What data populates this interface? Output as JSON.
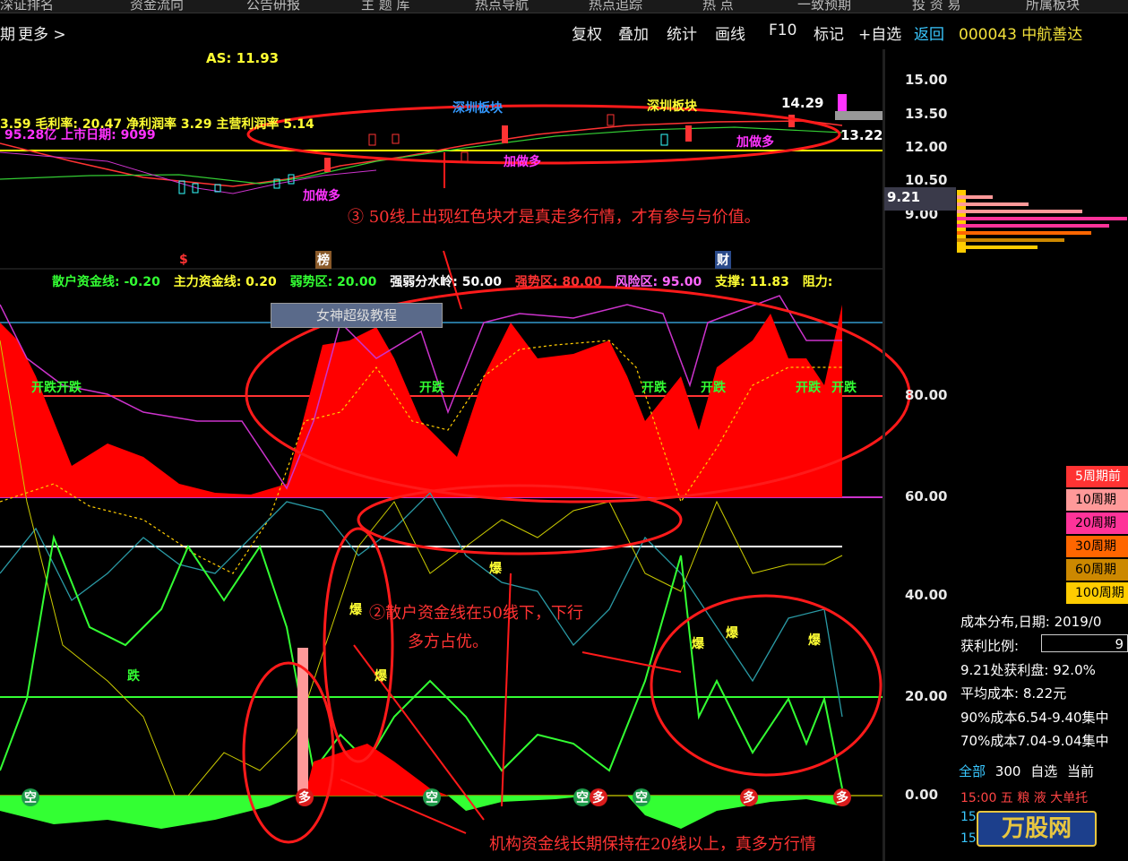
{
  "top_nav": [
    "深证排名",
    "资金流向",
    "公告研报",
    "主 题 库",
    "热点导航",
    "热点追踪",
    "热 点",
    "一致预期",
    "投 资 易",
    "所属板块"
  ],
  "toolbar": {
    "left_partial": "期",
    "more": "更多 >",
    "items": [
      "复权",
      "叠加",
      "统计",
      "画线",
      "F10",
      "标记",
      "+自选"
    ],
    "return": "返回",
    "stock": "000043 中航善达"
  },
  "price_chart": {
    "as_label": "AS: 11.93",
    "info_line1": "3.59 毛利率: 20.47 净利润率 3.29 主营利润率 5.14",
    "info_line2": "95.28亿 上市日期: 9099",
    "tags": [
      "深圳板块",
      "深圳板块",
      "加做多",
      "加做多",
      "加做多"
    ],
    "high_label": "14.29",
    "last_label": "13.22",
    "current_price": "9.21",
    "y_ticks": [
      "15.00",
      "13.50",
      "12.00",
      "10.50",
      "9.00"
    ],
    "markers": [
      "$",
      "榜",
      "财"
    ]
  },
  "indicator": {
    "header": [
      {
        "text": "散户资金线: -0.20",
        "color": "#33ff33"
      },
      {
        "text": "主力资金线: 0.20",
        "color": "#ffff33"
      },
      {
        "text": "弱势区: 20.00",
        "color": "#33ff33"
      },
      {
        "text": "强弱分水岭: 50.00",
        "color": "#ffffff"
      },
      {
        "text": "强势区: 80.00",
        "color": "#ff3333"
      },
      {
        "text": "风险区: 95.00",
        "color": "#ff66ff"
      },
      {
        "text": "支撑: 11.83",
        "color": "#ffff33"
      },
      {
        "text": "阻力: ",
        "color": "#ffff33"
      }
    ],
    "banner": "女神超级教程",
    "y_ticks": [
      "80.00",
      "60.00",
      "40.00",
      "20.00",
      "0.00"
    ],
    "kai_labels": [
      "开跌开跌",
      "开跌",
      "开跌",
      "开跌",
      "开跌",
      "开跌"
    ],
    "bao_labels": [
      "爆",
      "爆",
      "爆",
      "爆",
      "爆",
      "爆"
    ],
    "die_label": "跌",
    "kong_labels": [
      "空",
      "空",
      "空",
      "空"
    ],
    "duo_labels": [
      "多",
      "多",
      "多",
      "多"
    ]
  },
  "annotations": {
    "a3": "③ 50线上出现红色块才是真走多行情，才有参与与价值。",
    "a2_line1": "②散户资金线在50线下，下行",
    "a2_line2": "多方占优。",
    "a1": "机构资金线长期保持在20线以上，真多方行情"
  },
  "cost_panel": {
    "legend": [
      {
        "label": "5周期前",
        "color": "#ff3333"
      },
      {
        "label": "10周期",
        "color": "#ff9999"
      },
      {
        "label": "20周期",
        "color": "#ff3399"
      },
      {
        "label": "30周期",
        "color": "#ff6600"
      },
      {
        "label": "60周期",
        "color": "#cc8800"
      },
      {
        "label": "100周期",
        "color": "#ffcc00"
      }
    ],
    "title": "成本分布,日期: 2019/0",
    "profit_ratio_label": "获利比例:",
    "profit_ratio_value": "9",
    "profit_at": "9.21处获利盘: 92.0%",
    "avg_cost": "平均成本: 8.22元",
    "c90": "90%成本6.54-9.40集中",
    "c70": "70%成本7.04-9.04集中",
    "tabs": [
      "全部",
      "300",
      "自选",
      "当前"
    ],
    "ticker": [
      "15:00 五 粮 液 大单托",
      "15:00",
      "15:00"
    ]
  },
  "watermark": "万股网"
}
